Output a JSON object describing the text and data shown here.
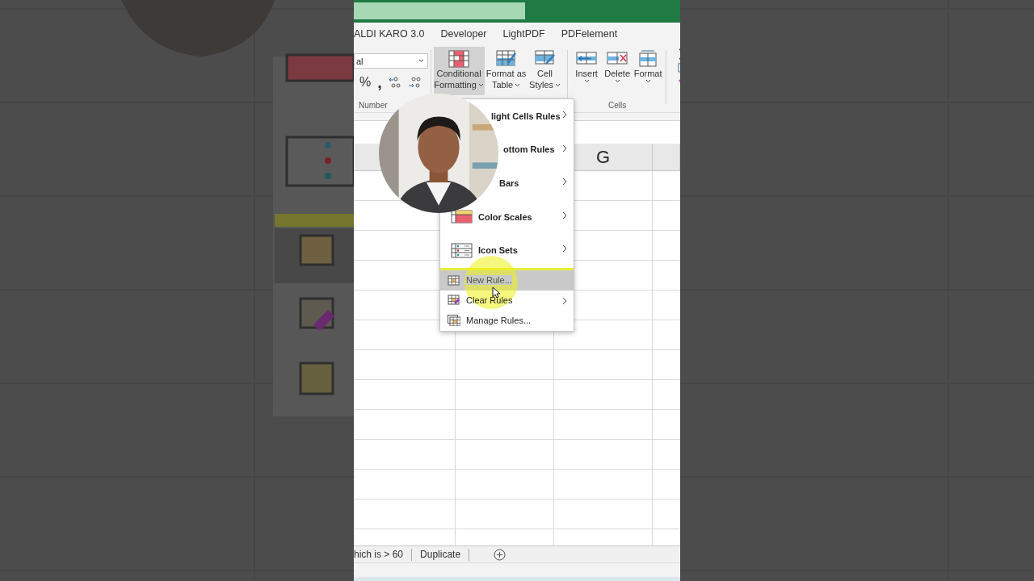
{
  "ribbon_tabs": [
    {
      "label": "ALDI KARO 3.0"
    },
    {
      "label": "Developer"
    },
    {
      "label": "LightPDF"
    },
    {
      "label": "PDFelement"
    }
  ],
  "ribbon": {
    "number_group": {
      "format_value": "al",
      "symbols": [
        "%",
        ","
      ],
      "label": "Number"
    },
    "styles_buttons": [
      {
        "lines": [
          "Conditional",
          "Formatting"
        ],
        "dropdown": true,
        "selected": true
      },
      {
        "lines": [
          "Format as",
          "Table"
        ],
        "dropdown": true,
        "selected": false
      },
      {
        "lines": [
          "Cell",
          "Styles"
        ],
        "dropdown": true,
        "selected": false
      }
    ],
    "cells_group": {
      "buttons": [
        {
          "label": "Insert",
          "dropdown": true
        },
        {
          "label": "Delete",
          "dropdown": true
        },
        {
          "label": "Format",
          "dropdown": true
        }
      ],
      "label": "Cells"
    }
  },
  "sheet": {
    "column_header": "G"
  },
  "context_menu": {
    "items": [
      {
        "kind": "large",
        "label": "light Cells Rules",
        "submenu": true,
        "selected": false
      },
      {
        "kind": "large",
        "label": "ottom Rules",
        "submenu": true,
        "selected": false
      },
      {
        "kind": "large",
        "label": "Bars",
        "submenu": true,
        "selected": false
      },
      {
        "kind": "large",
        "label": "Color Scales",
        "submenu": true,
        "selected": false
      },
      {
        "kind": "large",
        "label": "Icon Sets",
        "submenu": true,
        "selected": false
      },
      {
        "kind": "small",
        "label": "New Rule...",
        "submenu": false,
        "selected": true
      },
      {
        "kind": "small",
        "label": "Clear Rules",
        "submenu": true,
        "selected": false
      },
      {
        "kind": "small",
        "label": "Manage Rules...",
        "submenu": false,
        "selected": false
      }
    ]
  },
  "sheet_tabs": [
    {
      "label": "hich is > 60"
    },
    {
      "label": "Duplicate"
    }
  ]
}
